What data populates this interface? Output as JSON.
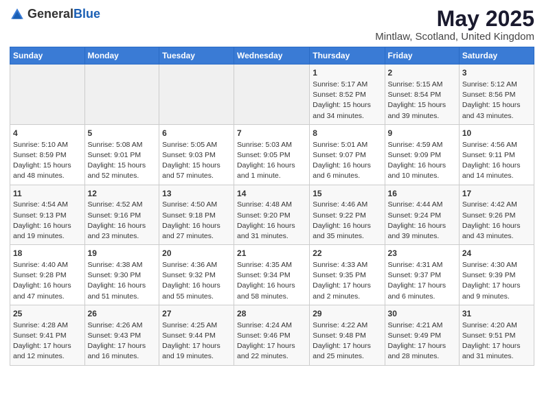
{
  "logo": {
    "general": "General",
    "blue": "Blue",
    "icon_title": "GeneralBlue logo"
  },
  "title": "May 2025",
  "subtitle": "Mintlaw, Scotland, United Kingdom",
  "days_of_week": [
    "Sunday",
    "Monday",
    "Tuesday",
    "Wednesday",
    "Thursday",
    "Friday",
    "Saturday"
  ],
  "weeks": [
    [
      {
        "day": "",
        "info": ""
      },
      {
        "day": "",
        "info": ""
      },
      {
        "day": "",
        "info": ""
      },
      {
        "day": "",
        "info": ""
      },
      {
        "day": "1",
        "info": "Sunrise: 5:17 AM\nSunset: 8:52 PM\nDaylight: 15 hours\nand 34 minutes."
      },
      {
        "day": "2",
        "info": "Sunrise: 5:15 AM\nSunset: 8:54 PM\nDaylight: 15 hours\nand 39 minutes."
      },
      {
        "day": "3",
        "info": "Sunrise: 5:12 AM\nSunset: 8:56 PM\nDaylight: 15 hours\nand 43 minutes."
      }
    ],
    [
      {
        "day": "4",
        "info": "Sunrise: 5:10 AM\nSunset: 8:59 PM\nDaylight: 15 hours\nand 48 minutes."
      },
      {
        "day": "5",
        "info": "Sunrise: 5:08 AM\nSunset: 9:01 PM\nDaylight: 15 hours\nand 52 minutes."
      },
      {
        "day": "6",
        "info": "Sunrise: 5:05 AM\nSunset: 9:03 PM\nDaylight: 15 hours\nand 57 minutes."
      },
      {
        "day": "7",
        "info": "Sunrise: 5:03 AM\nSunset: 9:05 PM\nDaylight: 16 hours\nand 1 minute."
      },
      {
        "day": "8",
        "info": "Sunrise: 5:01 AM\nSunset: 9:07 PM\nDaylight: 16 hours\nand 6 minutes."
      },
      {
        "day": "9",
        "info": "Sunrise: 4:59 AM\nSunset: 9:09 PM\nDaylight: 16 hours\nand 10 minutes."
      },
      {
        "day": "10",
        "info": "Sunrise: 4:56 AM\nSunset: 9:11 PM\nDaylight: 16 hours\nand 14 minutes."
      }
    ],
    [
      {
        "day": "11",
        "info": "Sunrise: 4:54 AM\nSunset: 9:13 PM\nDaylight: 16 hours\nand 19 minutes."
      },
      {
        "day": "12",
        "info": "Sunrise: 4:52 AM\nSunset: 9:16 PM\nDaylight: 16 hours\nand 23 minutes."
      },
      {
        "day": "13",
        "info": "Sunrise: 4:50 AM\nSunset: 9:18 PM\nDaylight: 16 hours\nand 27 minutes."
      },
      {
        "day": "14",
        "info": "Sunrise: 4:48 AM\nSunset: 9:20 PM\nDaylight: 16 hours\nand 31 minutes."
      },
      {
        "day": "15",
        "info": "Sunrise: 4:46 AM\nSunset: 9:22 PM\nDaylight: 16 hours\nand 35 minutes."
      },
      {
        "day": "16",
        "info": "Sunrise: 4:44 AM\nSunset: 9:24 PM\nDaylight: 16 hours\nand 39 minutes."
      },
      {
        "day": "17",
        "info": "Sunrise: 4:42 AM\nSunset: 9:26 PM\nDaylight: 16 hours\nand 43 minutes."
      }
    ],
    [
      {
        "day": "18",
        "info": "Sunrise: 4:40 AM\nSunset: 9:28 PM\nDaylight: 16 hours\nand 47 minutes."
      },
      {
        "day": "19",
        "info": "Sunrise: 4:38 AM\nSunset: 9:30 PM\nDaylight: 16 hours\nand 51 minutes."
      },
      {
        "day": "20",
        "info": "Sunrise: 4:36 AM\nSunset: 9:32 PM\nDaylight: 16 hours\nand 55 minutes."
      },
      {
        "day": "21",
        "info": "Sunrise: 4:35 AM\nSunset: 9:34 PM\nDaylight: 16 hours\nand 58 minutes."
      },
      {
        "day": "22",
        "info": "Sunrise: 4:33 AM\nSunset: 9:35 PM\nDaylight: 17 hours\nand 2 minutes."
      },
      {
        "day": "23",
        "info": "Sunrise: 4:31 AM\nSunset: 9:37 PM\nDaylight: 17 hours\nand 6 minutes."
      },
      {
        "day": "24",
        "info": "Sunrise: 4:30 AM\nSunset: 9:39 PM\nDaylight: 17 hours\nand 9 minutes."
      }
    ],
    [
      {
        "day": "25",
        "info": "Sunrise: 4:28 AM\nSunset: 9:41 PM\nDaylight: 17 hours\nand 12 minutes."
      },
      {
        "day": "26",
        "info": "Sunrise: 4:26 AM\nSunset: 9:43 PM\nDaylight: 17 hours\nand 16 minutes."
      },
      {
        "day": "27",
        "info": "Sunrise: 4:25 AM\nSunset: 9:44 PM\nDaylight: 17 hours\nand 19 minutes."
      },
      {
        "day": "28",
        "info": "Sunrise: 4:24 AM\nSunset: 9:46 PM\nDaylight: 17 hours\nand 22 minutes."
      },
      {
        "day": "29",
        "info": "Sunrise: 4:22 AM\nSunset: 9:48 PM\nDaylight: 17 hours\nand 25 minutes."
      },
      {
        "day": "30",
        "info": "Sunrise: 4:21 AM\nSunset: 9:49 PM\nDaylight: 17 hours\nand 28 minutes."
      },
      {
        "day": "31",
        "info": "Sunrise: 4:20 AM\nSunset: 9:51 PM\nDaylight: 17 hours\nand 31 minutes."
      }
    ]
  ]
}
